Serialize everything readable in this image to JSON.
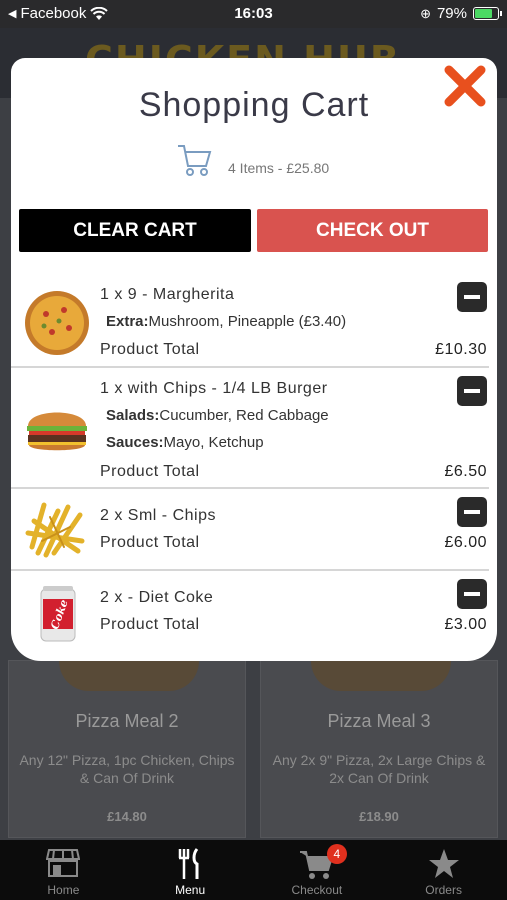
{
  "status_bar": {
    "back_app": "Facebook",
    "time": "16:03",
    "battery_pct": "79%",
    "battery_level": 0.79
  },
  "background": {
    "logo_text": "CHICKEN HUB",
    "cards": [
      {
        "title": "Pizza Meal 2",
        "description": "Any 12\" Pizza, 1pc Chicken, Chips & Can Of Drink",
        "price": "£14.80"
      },
      {
        "title": "Pizza Meal 3",
        "description": "Any 2x 9\" Pizza, 2x Large Chips & 2x Can Of Drink",
        "price": "£18.90"
      }
    ]
  },
  "modal": {
    "title": "Shopping Cart",
    "summary": "4 Items - £25.80",
    "clear_label": "CLEAR CART",
    "checkout_label": "CHECK OUT",
    "total_label": "Product Total",
    "items": [
      {
        "name": "1 x 9 - Margherita",
        "options": [
          {
            "key": "Extra:",
            "value": "Mushroom, Pineapple (£3.40)"
          }
        ],
        "total": "£10.30",
        "thumb": "pizza-icon"
      },
      {
        "name": "1 x with Chips - 1/4 LB Burger",
        "options": [
          {
            "key": "Salads:",
            "value": "Cucumber, Red Cabbage"
          },
          {
            "key": "Sauces:",
            "value": "Mayo, Ketchup"
          }
        ],
        "total": "£6.50",
        "thumb": "burger-icon"
      },
      {
        "name": "2 x Sml - Chips",
        "options": [],
        "total": "£6.00",
        "thumb": "chips-icon"
      },
      {
        "name": "2 x - Diet Coke",
        "options": [],
        "total": "£3.00",
        "thumb": "coke-can-icon",
        "can_text": "Coke"
      }
    ]
  },
  "nav": {
    "items": [
      {
        "label": "Home",
        "icon": "store-icon"
      },
      {
        "label": "Menu",
        "icon": "fork-knife-icon"
      },
      {
        "label": "Checkout",
        "icon": "cart-icon"
      },
      {
        "label": "Orders",
        "icon": "star-icon"
      }
    ],
    "badge": "4"
  },
  "colors": {
    "accent": "#d9534f",
    "close": "#e8501e",
    "dark": "#000000"
  }
}
